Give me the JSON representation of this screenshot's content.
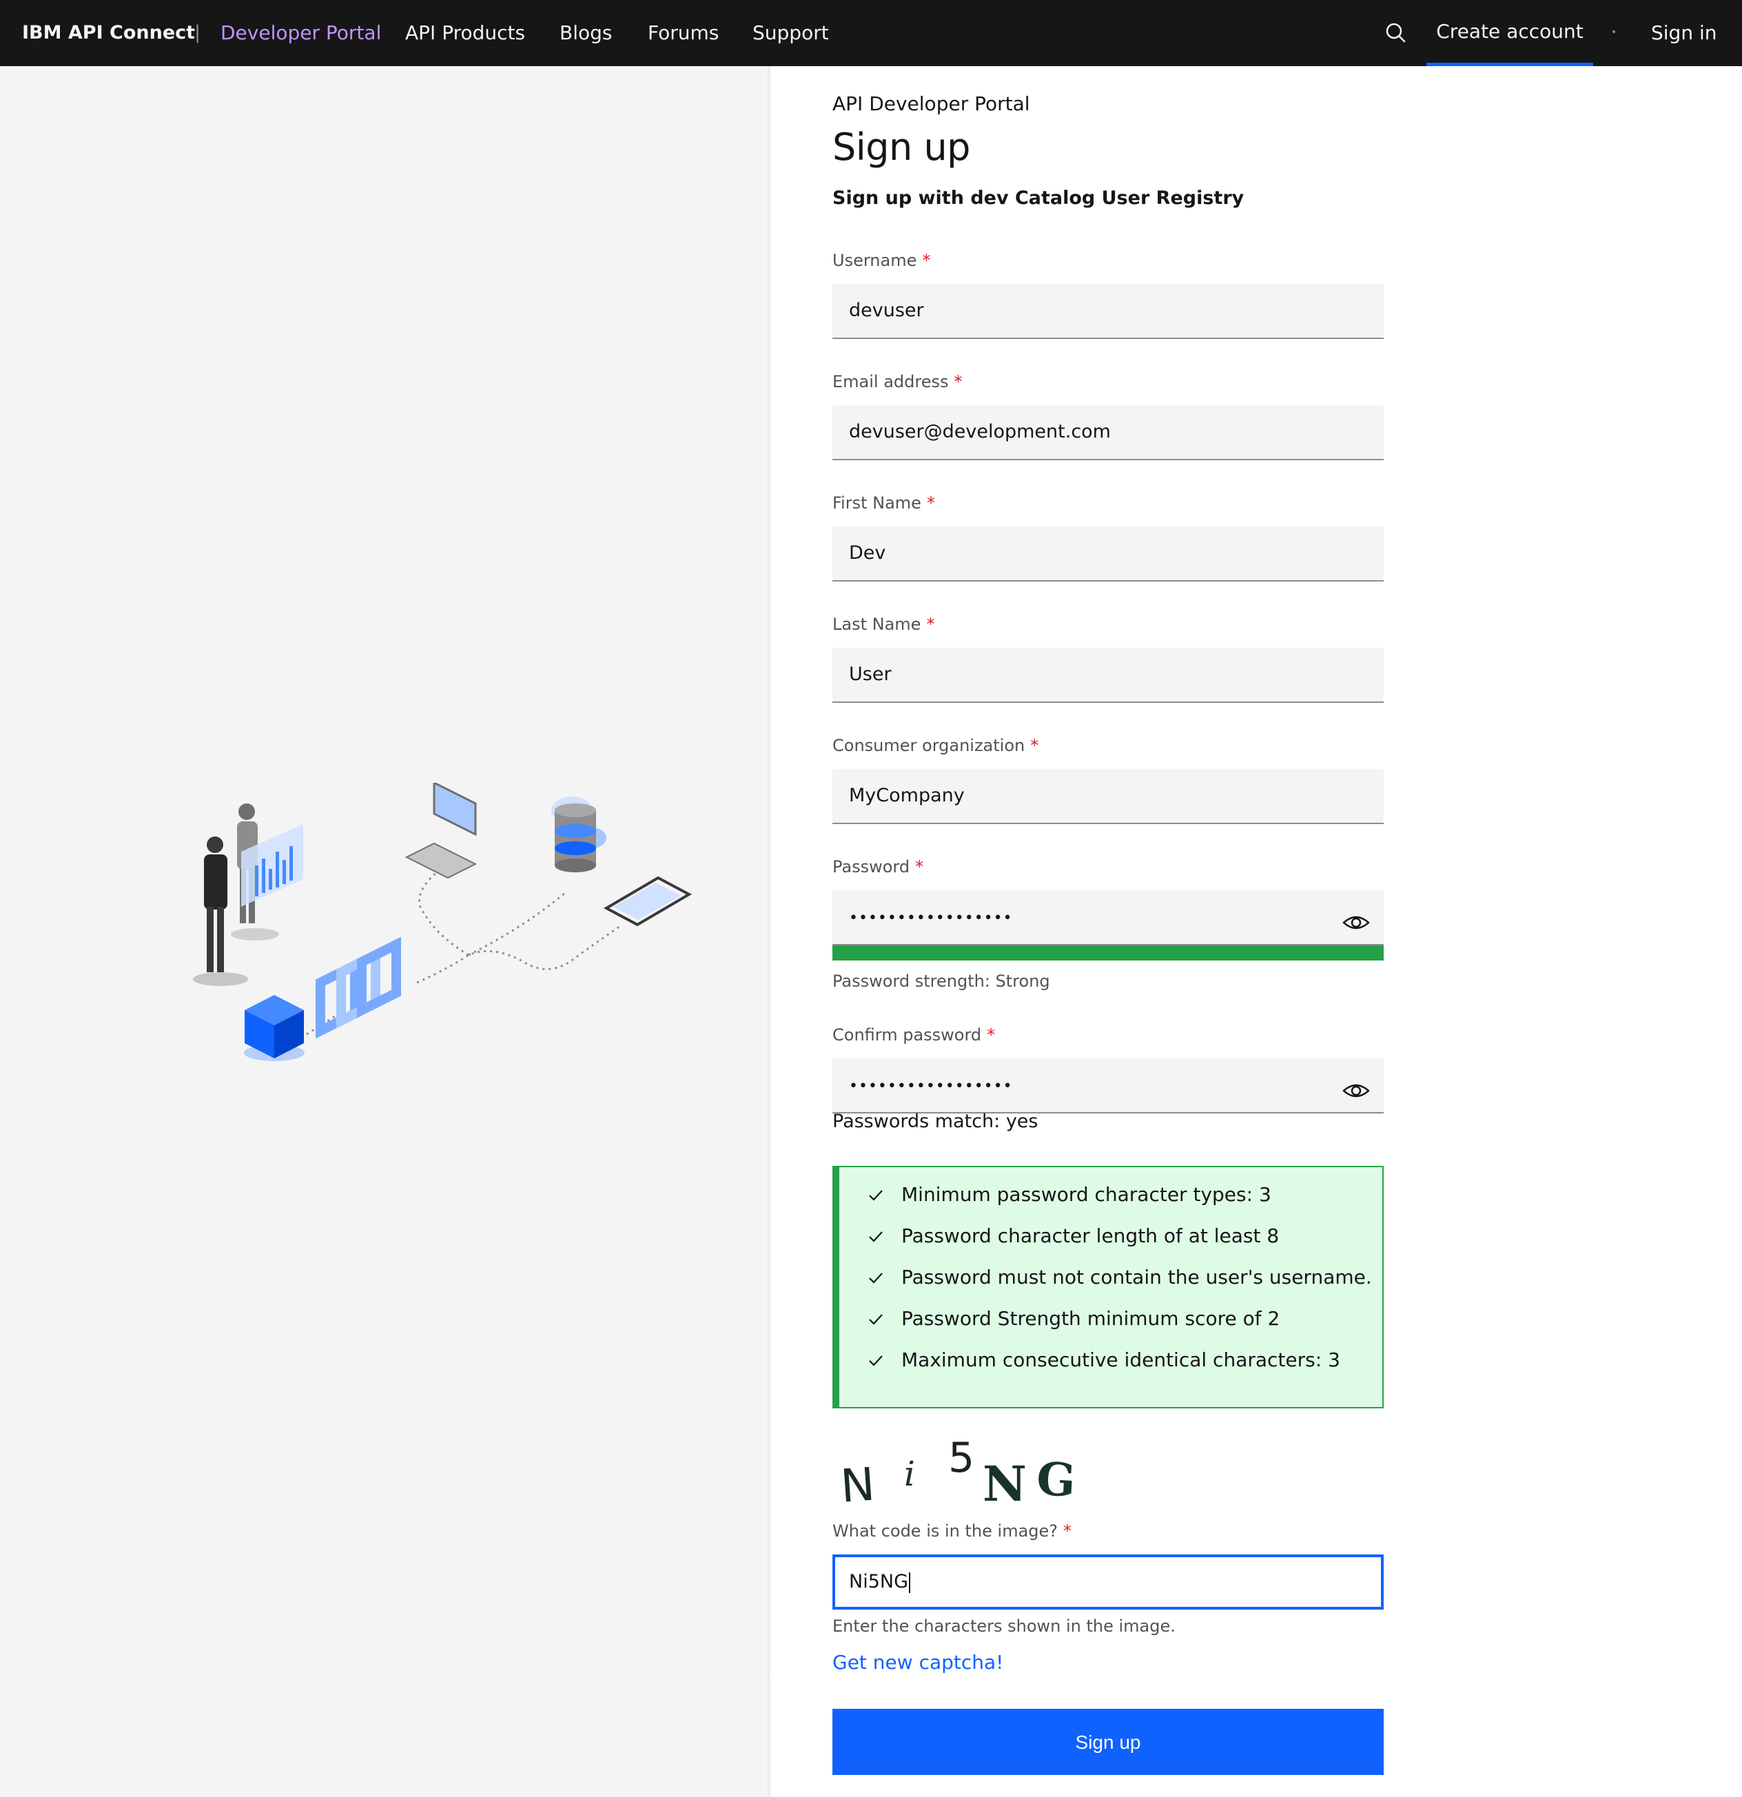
{
  "header": {
    "brand": "IBM API Connect",
    "separator": "|",
    "nav": [
      {
        "label": "Developer Portal",
        "active": true
      },
      {
        "label": "API Products",
        "active": false
      },
      {
        "label": "Blogs",
        "active": false
      },
      {
        "label": "Forums",
        "active": false
      },
      {
        "label": "Support",
        "active": false
      }
    ],
    "search_icon": "search-icon",
    "create_account": "Create account",
    "sign_in": "Sign in"
  },
  "form": {
    "eyebrow": "API Developer Portal",
    "title": "Sign up",
    "subtitle": "Sign up with dev Catalog User Registry",
    "required_marker": "*",
    "username": {
      "label": "Username",
      "value": "devuser"
    },
    "email": {
      "label": "Email address",
      "value": "devuser@development.com"
    },
    "first_name": {
      "label": "First Name",
      "value": "Dev"
    },
    "last_name": {
      "label": "Last Name",
      "value": "User"
    },
    "organization": {
      "label": "Consumer organization",
      "value": "MyCompany"
    },
    "password": {
      "label": "Password",
      "masked_value": "•••••••••••••••••",
      "strength_text": "Password strength: Strong",
      "strength_level": 1.0
    },
    "confirm_password": {
      "label": "Confirm password",
      "masked_value": "•••••••••••••••••",
      "match_text": "Passwords match: yes"
    },
    "rules": [
      "Minimum password character types: 3",
      "Password character length of at least 8",
      "Password must not contain the user's username.",
      "Password Strength minimum score of 2",
      "Maximum consecutive identical characters: 3"
    ],
    "captcha": {
      "image_text": "Ni5NG",
      "label": "What code is in the image?",
      "value": "Ni5NG",
      "helper": "Enter the characters shown in the image.",
      "refresh_link": "Get new captcha!"
    },
    "submit": "Sign up"
  },
  "colors": {
    "header_bg": "#161616",
    "active_nav": "#be95ff",
    "primary": "#0f62fe",
    "success": "#24a148",
    "success_bg": "#defbe6",
    "required": "#da1e28"
  }
}
